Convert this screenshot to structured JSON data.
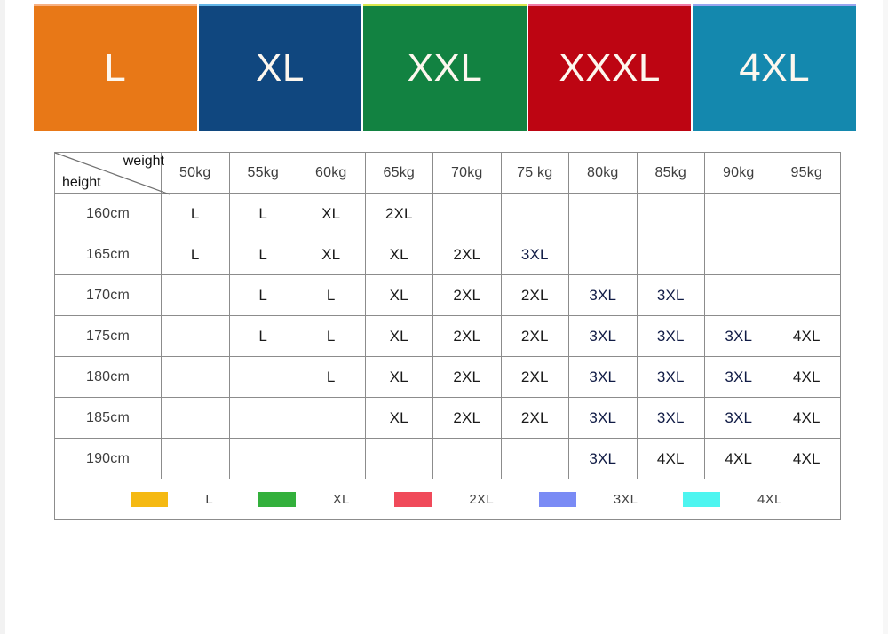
{
  "banner": {
    "items": [
      {
        "label": "L",
        "bg": "#e87817",
        "top": "#f7b183"
      },
      {
        "label": "XL",
        "bg": "#10477f",
        "top": "#63b6e8"
      },
      {
        "label": "XXL",
        "bg": "#128241",
        "top": "#d9e84f"
      },
      {
        "label": "XXXL",
        "bg": "#bd0512",
        "top": "#f07ba8"
      },
      {
        "label": "4XL",
        "bg": "#1488ae",
        "top": "#9aa5ef"
      }
    ]
  },
  "table": {
    "corner": {
      "weight_label": "weight",
      "height_label": "height"
    },
    "weight_headers": [
      "50kg",
      "55kg",
      "60kg",
      "65kg",
      "70kg",
      "75 kg",
      "80kg",
      "85kg",
      "90kg",
      "95kg"
    ],
    "height_headers": [
      "160cm",
      "165cm",
      "170cm",
      "175cm",
      "180cm",
      "185cm",
      "190cm"
    ],
    "rows": [
      {
        "height": "160cm",
        "cells": [
          "L",
          "L",
          "XL",
          "2XL",
          "",
          "",
          "",
          "",
          "",
          ""
        ]
      },
      {
        "height": "165cm",
        "cells": [
          "L",
          "L",
          "XL",
          "XL",
          "2XL",
          "3XL",
          "",
          "",
          "",
          ""
        ]
      },
      {
        "height": "170cm",
        "cells": [
          "",
          "L",
          "L",
          "XL",
          "2XL",
          "2XL",
          "3XL",
          "3XL",
          "",
          ""
        ]
      },
      {
        "height": "175cm",
        "cells": [
          "",
          "L",
          "L",
          "XL",
          "2XL",
          "2XL",
          "3XL",
          "3XL",
          "3XL",
          "4XL"
        ]
      },
      {
        "height": "180cm",
        "cells": [
          "",
          "",
          "L",
          "XL",
          "2XL",
          "2XL",
          "3XL",
          "3XL",
          "3XL",
          "4XL"
        ]
      },
      {
        "height": "185cm",
        "cells": [
          "",
          "",
          "",
          "XL",
          "2XL",
          "2XL",
          "3XL",
          "3XL",
          "3XL",
          "4XL"
        ]
      },
      {
        "height": "190cm",
        "cells": [
          "",
          "",
          "",
          "",
          "",
          "",
          "3XL",
          "4XL",
          "4XL",
          "4XL"
        ]
      }
    ]
  },
  "legend": {
    "items": [
      {
        "label": "L",
        "color": "#f5b912"
      },
      {
        "label": "XL",
        "color": "#33b03c"
      },
      {
        "label": "2XL",
        "color": "#f04a5a"
      },
      {
        "label": "3XL",
        "color": "#7a8bf5"
      },
      {
        "label": "4XL",
        "color": "#4df5f0"
      }
    ]
  },
  "chart_data": {
    "type": "table",
    "title": "Size recommendation chart (height x weight)",
    "xlabel": "weight",
    "ylabel": "height",
    "categories": [
      "50kg",
      "55kg",
      "60kg",
      "65kg",
      "70kg",
      "75 kg",
      "80kg",
      "85kg",
      "90kg",
      "95kg"
    ],
    "rows": [
      "160cm",
      "165cm",
      "170cm",
      "175cm",
      "180cm",
      "185cm",
      "190cm"
    ],
    "values": [
      [
        "L",
        "L",
        "XL",
        "2XL",
        "",
        "",
        "",
        "",
        "",
        ""
      ],
      [
        "L",
        "L",
        "XL",
        "XL",
        "2XL",
        "3XL",
        "",
        "",
        "",
        ""
      ],
      [
        "",
        "L",
        "L",
        "XL",
        "2XL",
        "2XL",
        "3XL",
        "3XL",
        "",
        ""
      ],
      [
        "",
        "L",
        "L",
        "XL",
        "2XL",
        "2XL",
        "3XL",
        "3XL",
        "3XL",
        "4XL"
      ],
      [
        "",
        "",
        "L",
        "XL",
        "2XL",
        "2XL",
        "3XL",
        "3XL",
        "3XL",
        "4XL"
      ],
      [
        "",
        "",
        "",
        "XL",
        "2XL",
        "2XL",
        "3XL",
        "3XL",
        "3XL",
        "4XL"
      ],
      [
        "",
        "",
        "",
        "",
        "",
        "",
        "3XL",
        "4XL",
        "4XL",
        "4XL"
      ]
    ],
    "legend": [
      {
        "label": "L",
        "color": "#f5b912"
      },
      {
        "label": "XL",
        "color": "#33b03c"
      },
      {
        "label": "2XL",
        "color": "#f04a5a"
      },
      {
        "label": "3XL",
        "color": "#7a8bf5"
      },
      {
        "label": "4XL",
        "color": "#4df5f0"
      }
    ],
    "legend_position": "bottom",
    "grid": true
  }
}
